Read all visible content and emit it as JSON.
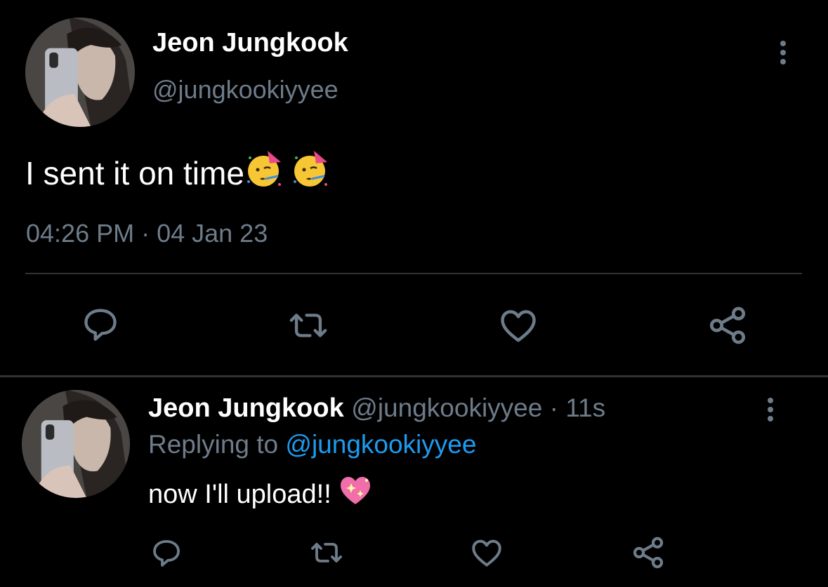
{
  "main_tweet": {
    "display_name": "Jeon Jungkook",
    "handle": "@jungkookiyyee",
    "text": "I sent it on time",
    "emojis": [
      "partying-face-emoji",
      "partying-face-emoji"
    ],
    "timestamp": "04:26 PM · 04 Jan 23",
    "actions": [
      "reply-icon",
      "retweet-icon",
      "like-icon",
      "share-icon"
    ]
  },
  "reply_tweet": {
    "display_name": "Jeon Jungkook",
    "handle_time": "@jungkookiyyee · 11s",
    "replying_label": "Replying to",
    "replying_handle": "@jungkookiyyee",
    "text": "now I'll upload!!",
    "emojis": [
      "sparkling-heart-emoji"
    ],
    "actions": [
      "reply-icon",
      "retweet-icon",
      "like-icon",
      "share-icon"
    ]
  },
  "colors": {
    "background": "#000000",
    "muted": "#6e7c8a",
    "link": "#1d9bf0",
    "divider": "#2f3336"
  }
}
